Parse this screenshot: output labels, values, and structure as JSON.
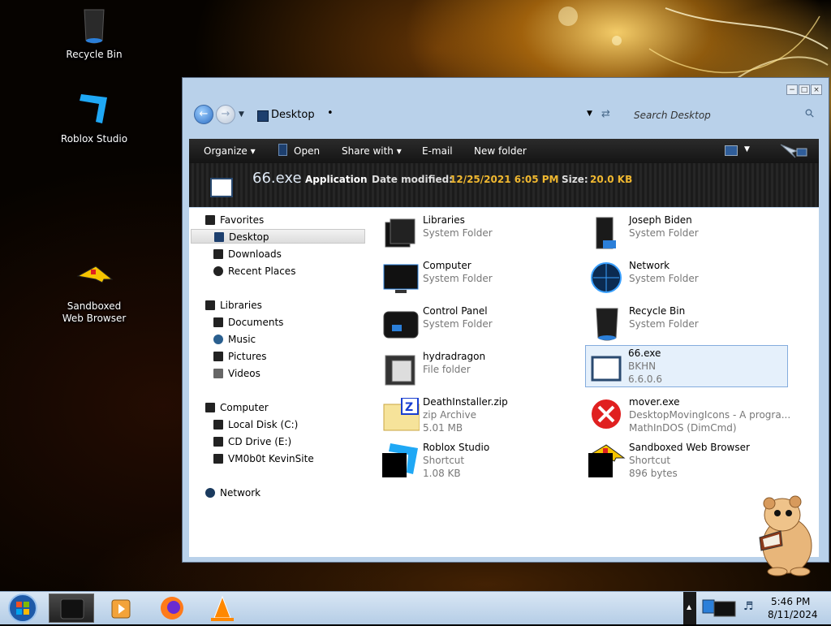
{
  "desktop": {
    "icons": [
      {
        "label": "Recycle Bin"
      },
      {
        "label": "Roblox Studio"
      },
      {
        "label": "Sandboxed\nWeb Browser"
      }
    ]
  },
  "window": {
    "controls": {
      "minimize": "−",
      "maximize": "□",
      "close": "×"
    },
    "address": {
      "crumb": "Desktop",
      "crumb_separator": "•",
      "search_placeholder": "Search Desktop"
    },
    "toolbar": {
      "organize": "Organize ▾",
      "open": "Open",
      "share_with": "Share with ▾",
      "email": "E-mail",
      "new_folder": "New folder"
    },
    "details": {
      "name": "66.exe",
      "type": "Application",
      "date_label": "Date modified:",
      "date": "12/25/2021 6:05 PM",
      "size_label": "Size:",
      "size": "20.0 KB"
    },
    "nav": {
      "favorites": "Favorites",
      "desktop": "Desktop",
      "downloads": "Downloads",
      "recent_places": "Recent Places",
      "libraries": "Libraries",
      "documents": "Documents",
      "music": "Music",
      "pictures": "Pictures",
      "videos": "Videos",
      "computer": "Computer",
      "local_disk": "Local Disk (C:)",
      "cd_drive": "CD Drive (E:)",
      "vm": "VM0b0t KevinSite",
      "network": "Network"
    },
    "files": [
      {
        "name": "Libraries",
        "type": "System Folder",
        "size": ""
      },
      {
        "name": "Joseph Biden",
        "type": "System Folder",
        "size": ""
      },
      {
        "name": "Computer",
        "type": "System Folder",
        "size": ""
      },
      {
        "name": "Network",
        "type": "System Folder",
        "size": ""
      },
      {
        "name": "Control Panel",
        "type": "System Folder",
        "size": ""
      },
      {
        "name": "Recycle Bin",
        "type": "System Folder",
        "size": ""
      },
      {
        "name": "hydradragon",
        "type": "File folder",
        "size": ""
      },
      {
        "name": "66.exe",
        "type": "BKHN",
        "size": "6.6.0.6"
      },
      {
        "name": "DeathInstaller.zip",
        "type": "zip Archive",
        "size": "5.01 MB"
      },
      {
        "name": "mover.exe",
        "type": "DesktopMovingIcons - A progra...",
        "size": "MathInDOS (DimCmd)"
      },
      {
        "name": "Roblox Studio",
        "type": "Shortcut",
        "size": "1.08 KB"
      },
      {
        "name": "Sandboxed Web Browser",
        "type": "Shortcut",
        "size": "896 bytes"
      }
    ]
  },
  "taskbar": {
    "time": "5:46 PM",
    "date": "8/11/2024"
  },
  "colors": {
    "accent_date": "#f0b830",
    "window_frame": "#b9d1ea",
    "selection": "#e5f0fb"
  }
}
